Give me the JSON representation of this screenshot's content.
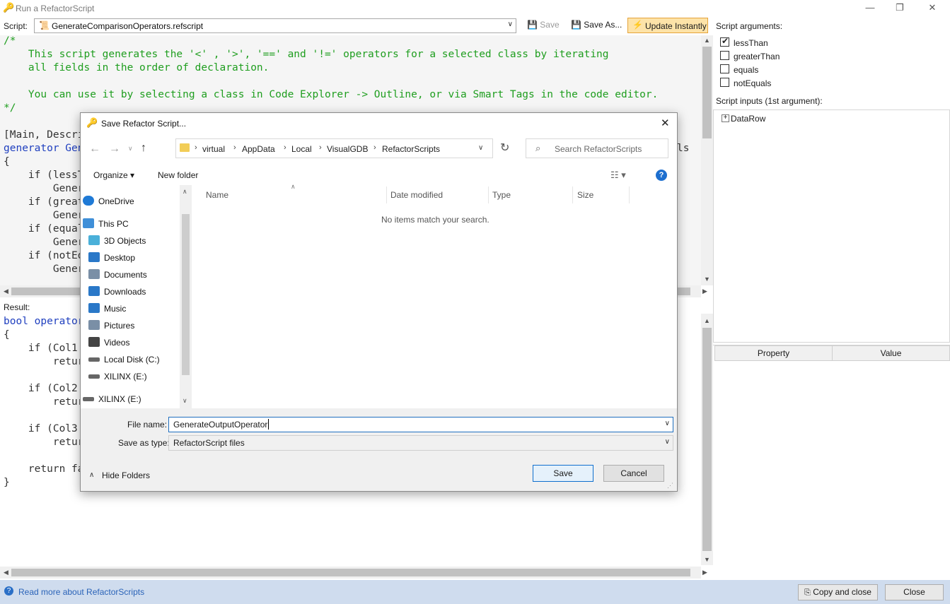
{
  "window": {
    "title": "Run a RefactorScript"
  },
  "toolbar": {
    "script_label": "Script:",
    "script_file": "GenerateComparisonOperators.refscript",
    "save_label": "Save",
    "save_as_label": "Save As...",
    "update_label": "Update Instantly"
  },
  "editor": {
    "lines": [
      "/*",
      "    This script generates the '<' , '>', '==' and '!=' operators for a selected class by iterating",
      "    all fields in the order of declaration.",
      "",
      "    You can use it by selecting a class in Code Explorer -> Outline, or via Smart Tags in the code editor.",
      "*/",
      "",
      "[Main, Descri",
      "generator Gen",
      "{",
      "    if (lessT",
      "        Gener",
      "    if (great",
      "        Gener",
      "    if (equal",
      "        Gener",
      "    if (notEq",
      "        Gener"
    ],
    "line_tail": "ls"
  },
  "result": {
    "label": "Result:",
    "lines": [
      "bool operator",
      "{",
      "    if (Col1",
      "        retur",
      "",
      "    if (Col2",
      "        retur",
      "",
      "    if (Col3",
      "        retur",
      "",
      "    return fa",
      "}"
    ]
  },
  "args": {
    "label": "Script arguments:",
    "items": [
      {
        "label": "lessThan",
        "checked": true
      },
      {
        "label": "greaterThan",
        "checked": false
      },
      {
        "label": "equals",
        "checked": false
      },
      {
        "label": "notEquals",
        "checked": false
      }
    ]
  },
  "inputs": {
    "label": "Script inputs (1st argument):",
    "tree_item": "DataRow"
  },
  "props": {
    "col_property": "Property",
    "col_value": "Value"
  },
  "status": {
    "link": "Read more about RefactorScripts",
    "copy_close": "Copy and close",
    "close": "Close"
  },
  "dialog": {
    "title": "Save Refactor Script...",
    "breadcrumb": [
      "virtual",
      "AppData",
      "Local",
      "VisualGDB",
      "RefactorScripts"
    ],
    "search_placeholder": "Search RefactorScripts",
    "organize": "Organize",
    "new_folder": "New folder",
    "nav": [
      {
        "label": "OneDrive",
        "icon": "cloud-icon"
      },
      {
        "label": "This PC",
        "icon": "computer-icon"
      },
      {
        "label": "3D Objects",
        "icon": "cube-icon"
      },
      {
        "label": "Desktop",
        "icon": "desktop-icon"
      },
      {
        "label": "Documents",
        "icon": "document-icon"
      },
      {
        "label": "Downloads",
        "icon": "download-icon"
      },
      {
        "label": "Music",
        "icon": "music-icon"
      },
      {
        "label": "Pictures",
        "icon": "pictures-icon"
      },
      {
        "label": "Videos",
        "icon": "video-icon"
      },
      {
        "label": "Local Disk (C:)",
        "icon": "drive-icon"
      },
      {
        "label": "XILINX (E:)",
        "icon": "drive-icon"
      },
      {
        "label": "XILINX (E:)",
        "icon": "drive-icon"
      }
    ],
    "columns": [
      "Name",
      "Date modified",
      "Type",
      "Size"
    ],
    "empty_message": "No items match your search.",
    "file_name_label": "File name:",
    "file_name_value": "GenerateOutputOperator",
    "save_type_label": "Save as type:",
    "save_type_value": "RefactorScript files",
    "hide_folders": "Hide Folders",
    "save_button": "Save",
    "cancel_button": "Cancel"
  }
}
